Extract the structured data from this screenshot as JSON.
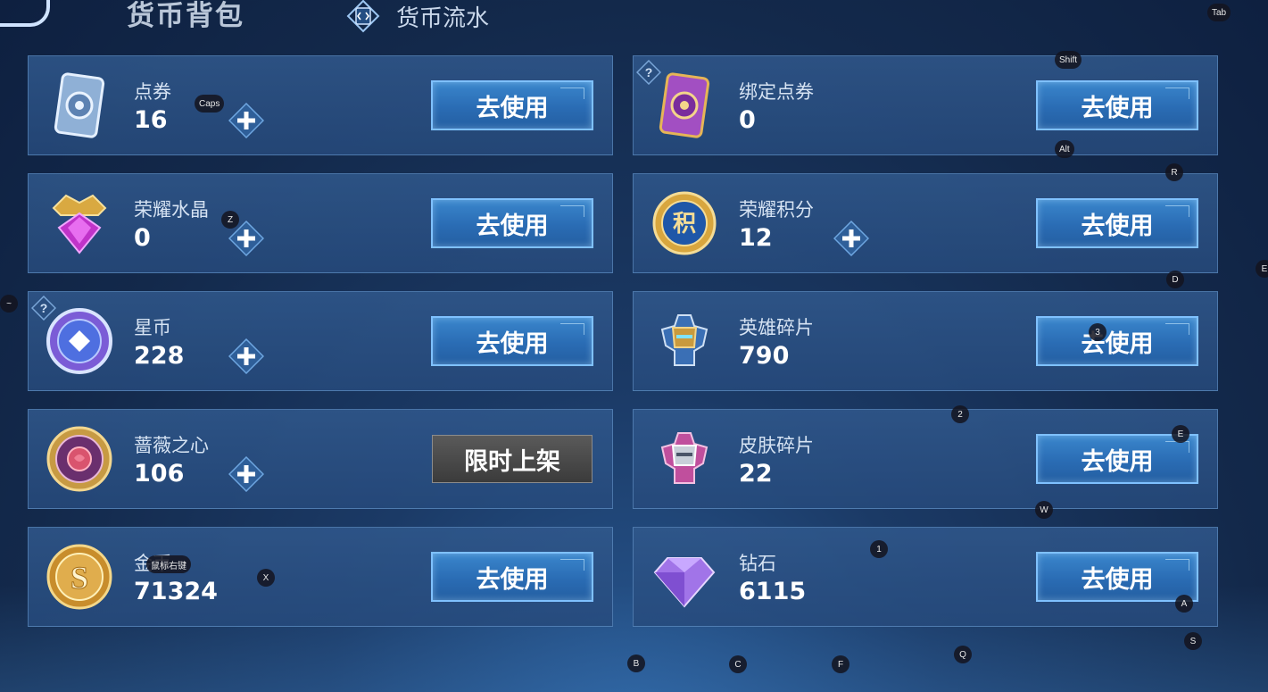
{
  "header": {
    "title": "货币背包",
    "flow_label": "货币流水"
  },
  "cards": [
    {
      "name": "点券",
      "amount": "16",
      "action": "去使用",
      "icon": "ticket-icon"
    },
    {
      "name": "绑定点券",
      "amount": "0",
      "action": "去使用",
      "icon": "bound-ticket-icon"
    },
    {
      "name": "荣耀水晶",
      "amount": "0",
      "action": "去使用",
      "icon": "glory-crystal-icon"
    },
    {
      "name": "荣耀积分",
      "amount": "12",
      "action": "去使用",
      "icon": "glory-points-icon"
    },
    {
      "name": "星币",
      "amount": "228",
      "action": "去使用",
      "icon": "star-coin-icon"
    },
    {
      "name": "英雄碎片",
      "amount": "790",
      "action": "去使用",
      "icon": "hero-fragment-icon"
    },
    {
      "name": "蔷薇之心",
      "amount": "106",
      "action": "限时上架",
      "icon": "rose-heart-icon"
    },
    {
      "name": "皮肤碎片",
      "amount": "22",
      "action": "去使用",
      "icon": "skin-fragment-icon"
    },
    {
      "name": "金币",
      "amount": "71324",
      "action": "去使用",
      "icon": "gold-coin-icon"
    },
    {
      "name": "钻石",
      "amount": "6115",
      "action": "去使用",
      "icon": "diamond-icon"
    }
  ],
  "hints": [
    "Tab",
    "Shift",
    "Caps",
    "Alt",
    "R",
    "Z",
    "D",
    "E",
    "~",
    "3",
    "2",
    "E",
    "W",
    "1",
    "X",
    "A",
    "S",
    "B",
    "C",
    "F",
    "Q"
  ],
  "hint_mouse": "鼠标右键",
  "colors": {
    "accent_button": "#2a6cb4",
    "card_border": "#78aae1",
    "limited_button": "#4a4a4a"
  }
}
